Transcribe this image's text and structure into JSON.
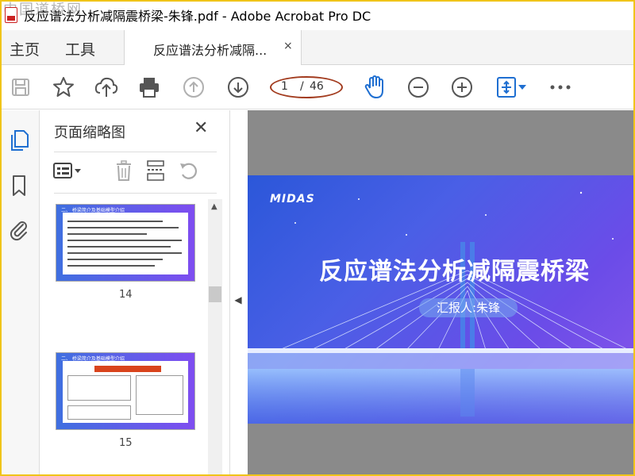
{
  "window": {
    "title": "反应谱法分析减隔震桥梁-朱锋.pdf - Adobe Acrobat Pro DC",
    "watermark": "中国道桥网"
  },
  "tabs": {
    "home": "主页",
    "tools": "工具",
    "document": "反应谱法分析减隔...",
    "close_symbol": "×"
  },
  "toolbar": {
    "icons": [
      "save-icon",
      "star-icon",
      "upload-icon",
      "print-icon",
      "page-up-icon",
      "page-down-icon",
      "hand-icon",
      "zoom-out-icon",
      "zoom-in-icon",
      "fit-page-icon",
      "more-icon"
    ],
    "current_page": "1",
    "separator": "/",
    "total_pages": "46"
  },
  "left_rail": {
    "icons": [
      "pages-icon",
      "bookmark-icon",
      "attachment-icon"
    ],
    "accent": "#1f6fd1"
  },
  "thumbnails_panel": {
    "title": "页面缩略图",
    "close_symbol": "✕",
    "pages": [
      {
        "number": "14",
        "heading": "二、 桥梁简介及基础模型介绍"
      },
      {
        "number": "15",
        "heading": "二、 桥梁简介及基础模型介绍"
      }
    ]
  },
  "slide": {
    "logo": "MIDAS",
    "title": "反应谱法分析减隔震桥梁",
    "reporter": "汇报人:朱锋"
  },
  "colors": {
    "frame": "#f0c419",
    "page_ellipse": "#a23b1e",
    "icon_blue": "#1f6fd1",
    "icon_gray": "#555555"
  }
}
